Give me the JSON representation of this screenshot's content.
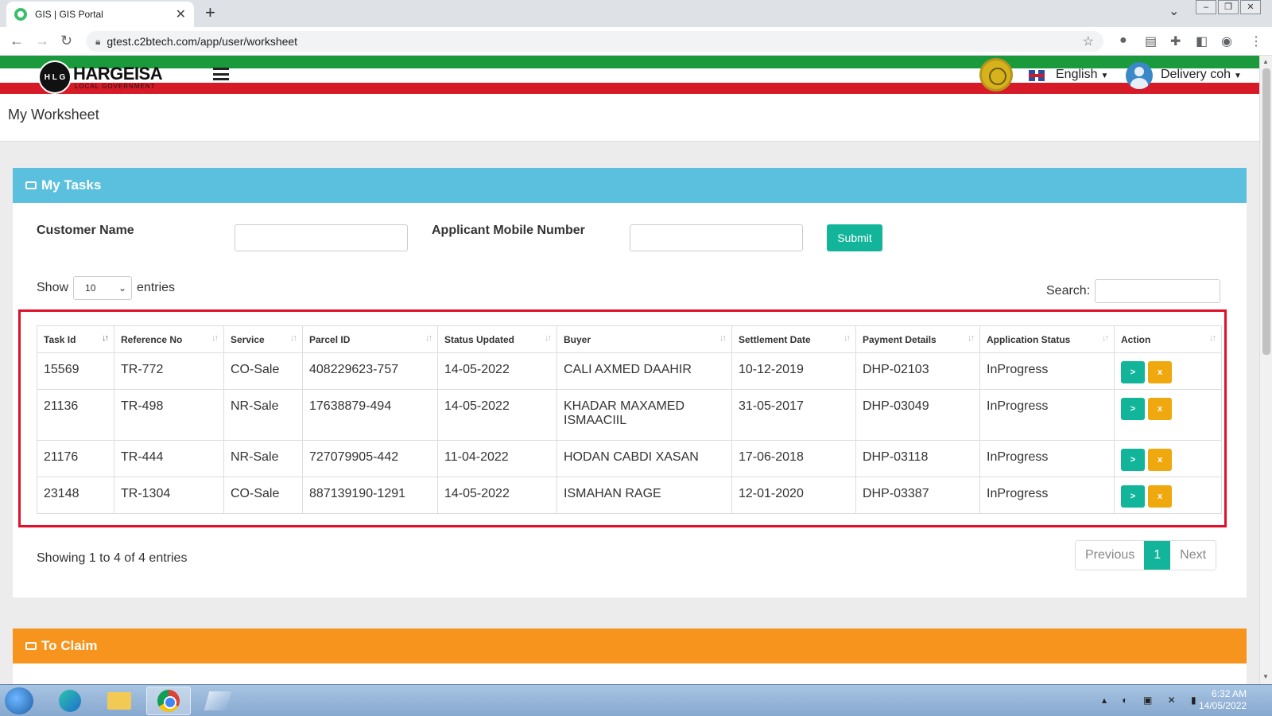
{
  "browser": {
    "tab_title": "GIS | GIS Portal",
    "url": "gtest.c2btech.com/app/user/worksheet"
  },
  "header": {
    "logo_text": "HARGEISA",
    "logo_sub": "LOCAL GOVERNMENT",
    "logo_initials": "H L G",
    "language": "English",
    "user": "Delivery coh"
  },
  "page_title": "My Worksheet",
  "tasks_panel": {
    "title": "My Tasks",
    "customer_name_label": "Customer Name",
    "customer_name_value": "",
    "mobile_label": "Applicant Mobile Number",
    "mobile_value": "",
    "submit_label": "Submit",
    "show_label": "Show",
    "entries_value": "10",
    "entries_label": "entries",
    "search_label": "Search:",
    "columns": [
      "Task Id",
      "Reference No",
      "Service",
      "Parcel ID",
      "Status Updated",
      "Buyer",
      "Settlement Date",
      "Payment Details",
      "Application Status",
      "Action"
    ],
    "rows": [
      [
        "15569",
        "TR-772",
        "CO-Sale",
        "408229623-757",
        "14-05-2022",
        "CALI AXMED DAAHIR",
        "10-12-2019",
        "DHP-02103",
        "InProgress"
      ],
      [
        "21136",
        "TR-498",
        "NR-Sale",
        "17638879-494",
        "14-05-2022",
        "KHADAR MAXAMED ISMAACIIL",
        "31-05-2017",
        "DHP-03049",
        "InProgress"
      ],
      [
        "21176",
        "TR-444",
        "NR-Sale",
        "727079905-442",
        "11-04-2022",
        "HODAN CABDI XASAN",
        "17-06-2018",
        "DHP-03118",
        "InProgress"
      ],
      [
        "23148",
        "TR-1304",
        "CO-Sale",
        "887139190-1291",
        "14-05-2022",
        "ISMAHAN RAGE",
        "12-01-2020",
        "DHP-03387",
        "InProgress"
      ]
    ],
    "action_go": ">",
    "action_x": "x",
    "showing_text": "Showing 1 to 4 of 4 entries",
    "pager": {
      "previous": "Previous",
      "current": "1",
      "next": "Next"
    }
  },
  "claim_panel": {
    "title": "To Claim"
  },
  "taskbar": {
    "time": "6:32 AM",
    "date": "14/05/2022"
  },
  "colors": {
    "tasks_header": "#5bc0de",
    "claim_header": "#f7941d",
    "primary": "#13b59a",
    "warning": "#f0a80f",
    "highlight": "#e0102a"
  }
}
